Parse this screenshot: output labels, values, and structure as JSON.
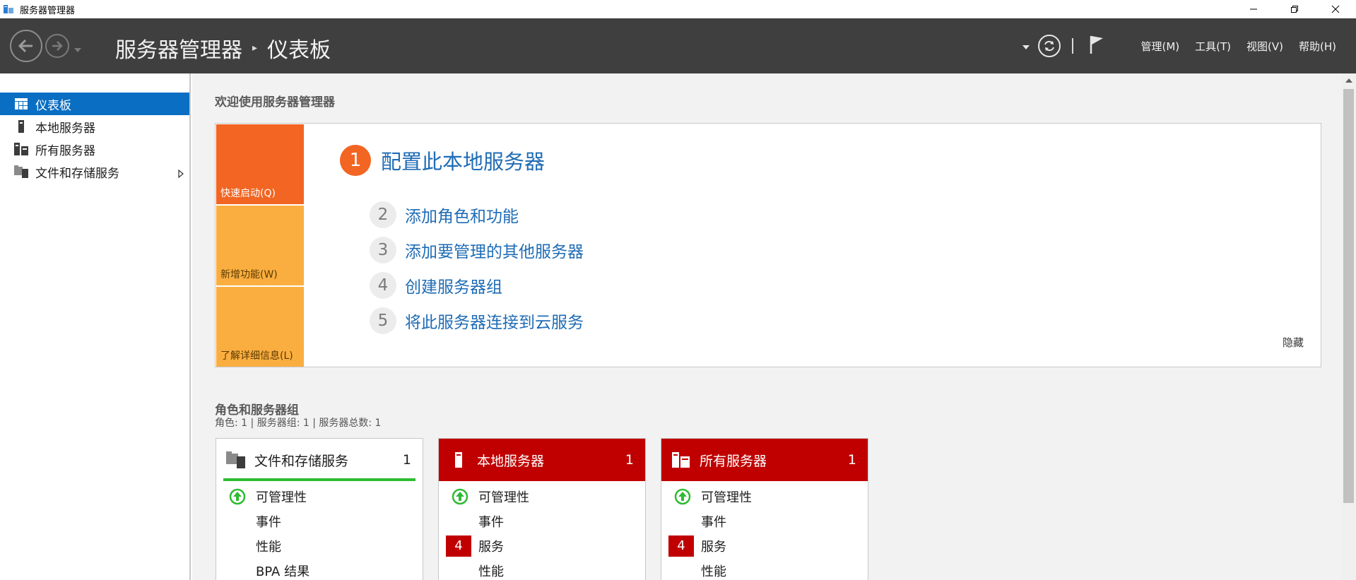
{
  "window": {
    "title": "服务器管理器"
  },
  "header": {
    "breadcrumb_root": "服务器管理器",
    "breadcrumb_sep": "▸",
    "breadcrumb_current": "仪表板",
    "menus": [
      "管理(M)",
      "工具(T)",
      "视图(V)",
      "帮助(H)"
    ]
  },
  "sidebar": {
    "items": [
      {
        "label": "仪表板",
        "icon": "dashboard-icon",
        "active": true
      },
      {
        "label": "本地服务器",
        "icon": "local-server-icon",
        "active": false
      },
      {
        "label": "所有服务器",
        "icon": "all-servers-icon",
        "active": false
      },
      {
        "label": "文件和存储服务",
        "icon": "file-storage-icon",
        "active": false,
        "expandable": true
      }
    ]
  },
  "welcome": {
    "title": "欢迎使用服务器管理器",
    "tiles": [
      "快速启动(Q)",
      "新增功能(W)",
      "了解详细信息(L)"
    ],
    "main_step": {
      "num": "1",
      "label": "配置此本地服务器"
    },
    "steps": [
      {
        "num": "2",
        "label": "添加角色和功能"
      },
      {
        "num": "3",
        "label": "添加要管理的其他服务器"
      },
      {
        "num": "4",
        "label": "创建服务器组"
      },
      {
        "num": "5",
        "label": "将此服务器连接到云服务"
      }
    ],
    "hide": "隐藏"
  },
  "roles": {
    "title": "角色和服务器组",
    "subtitle": "角色: 1 | 服务器组: 1 | 服务器总数: 1",
    "cards": [
      {
        "title": "文件和存储服务",
        "count": "1",
        "style": "plain",
        "rows": [
          {
            "label": "可管理性",
            "indicator": "up-arrow"
          },
          {
            "label": "事件",
            "indicator": ""
          },
          {
            "label": "性能",
            "indicator": ""
          },
          {
            "label": "BPA 结果",
            "indicator": ""
          }
        ]
      },
      {
        "title": "本地服务器",
        "count": "1",
        "style": "red",
        "rows": [
          {
            "label": "可管理性",
            "indicator": "up-arrow"
          },
          {
            "label": "事件",
            "indicator": ""
          },
          {
            "label": "服务",
            "indicator": "4"
          },
          {
            "label": "性能",
            "indicator": ""
          }
        ]
      },
      {
        "title": "所有服务器",
        "count": "1",
        "style": "red",
        "rows": [
          {
            "label": "可管理性",
            "indicator": "up-arrow"
          },
          {
            "label": "事件",
            "indicator": ""
          },
          {
            "label": "服务",
            "indicator": "4"
          },
          {
            "label": "性能",
            "indicator": ""
          }
        ]
      }
    ]
  },
  "colors": {
    "header_bg": "#3f3f3f",
    "active_blue": "#0a6ec2",
    "link_blue": "#1f6cb5",
    "quickstart_orange": "#f26522",
    "tile_amber": "#fbae40",
    "alert_red": "#c00000",
    "ok_green": "#2fbb33"
  }
}
